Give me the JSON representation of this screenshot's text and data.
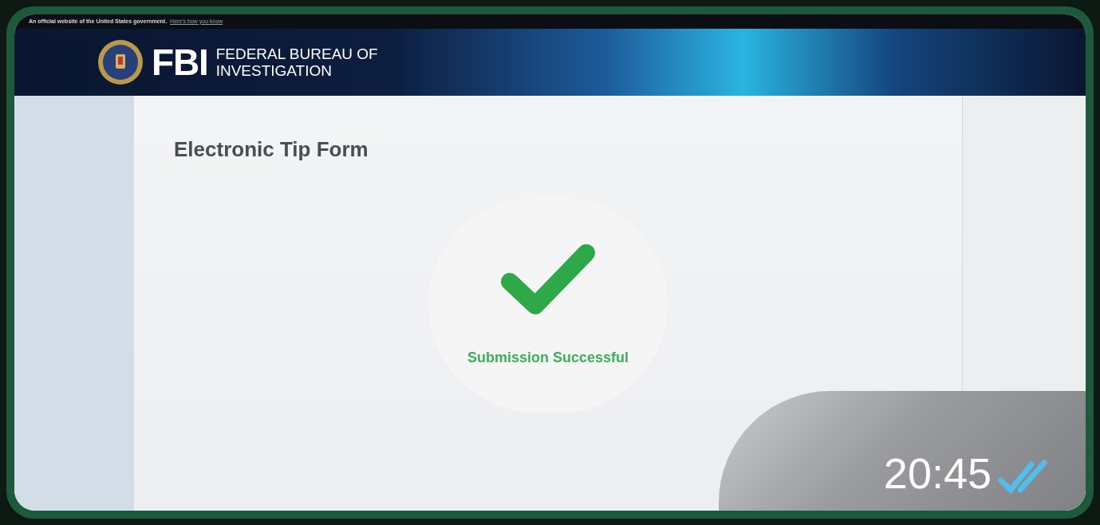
{
  "gov_banner": {
    "text": "An official website of the United States government.",
    "link": "Here's how you know"
  },
  "header": {
    "logo_text": "FBI",
    "agency_line_1": "FEDERAL BUREAU OF",
    "agency_line_2": "INVESTIGATION"
  },
  "page": {
    "title": "Electronic Tip Form",
    "status": "Submission Successful"
  },
  "message": {
    "time": "20:45",
    "read": true
  }
}
